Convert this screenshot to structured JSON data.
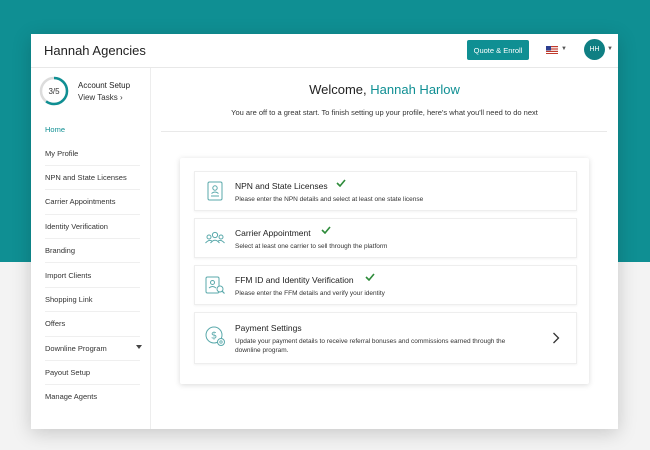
{
  "header": {
    "brand": "Hannah Agencies",
    "quote_label": "Quote & Enroll",
    "avatar_initials": "HH"
  },
  "sidebar": {
    "progress": "3/5",
    "progress_fraction": 0.6,
    "setup_title": "Account Setup",
    "view_tasks": "View Tasks ›",
    "items": [
      {
        "label": "Home"
      },
      {
        "label": "My Profile"
      },
      {
        "label": "NPN and State Licenses"
      },
      {
        "label": "Carrier Appointments"
      },
      {
        "label": "Identity Verification"
      },
      {
        "label": "Branding"
      },
      {
        "label": "Import Clients"
      },
      {
        "label": "Shopping Link"
      },
      {
        "label": "Offers"
      },
      {
        "label": "Downline Program"
      },
      {
        "label": "Payout Setup"
      },
      {
        "label": "Manage Agents"
      }
    ]
  },
  "main": {
    "welcome_prefix": "Welcome,",
    "welcome_name": "Hannah Harlow",
    "subtitle": "You are off to a great start. To finish setting up your profile, here's what you'll need to do next",
    "tasks": [
      {
        "title": "NPN and State Licenses",
        "desc": "Please enter the NPN details and select at least one state license"
      },
      {
        "title": "Carrier Appointment",
        "desc": "Select at least one carrier to sell through the platform"
      },
      {
        "title": "FFM ID and Identity Verification",
        "desc": "Please enter the FFM details and verify your identity"
      },
      {
        "title": "Payment Settings",
        "desc": "Update your payment details to receive referral bonuses and commissions earned through the downline program."
      }
    ]
  },
  "colors": {
    "accent": "#0f8f93",
    "check": "#2e8b3a"
  }
}
